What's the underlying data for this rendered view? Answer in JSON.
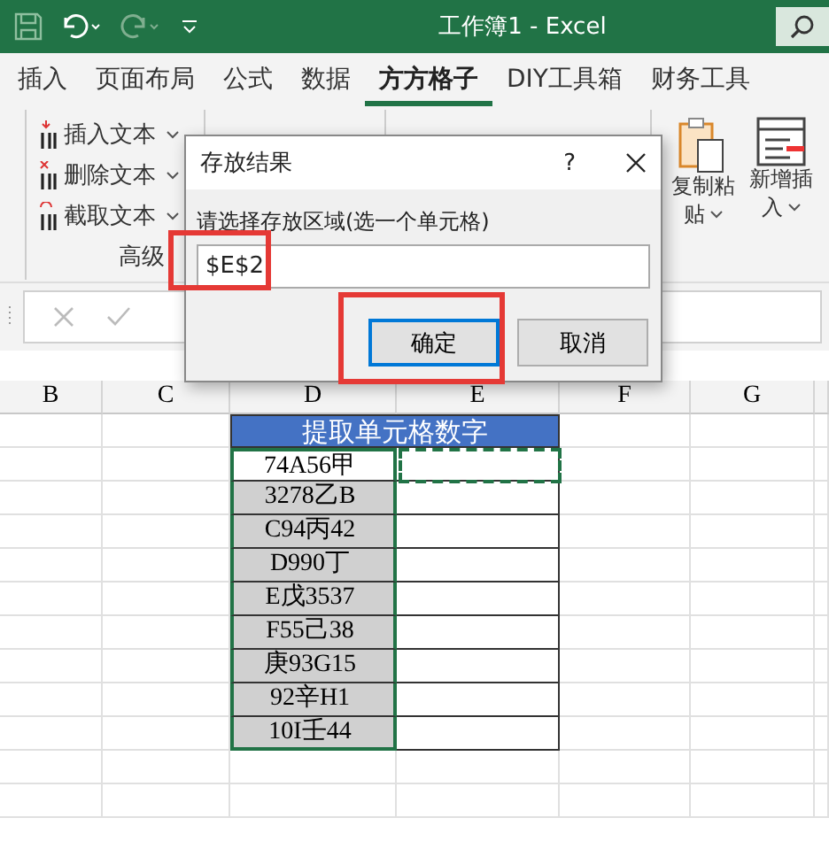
{
  "window": {
    "title": "工作簿1 - Excel"
  },
  "tabs": [
    {
      "label": "插入",
      "selected": false
    },
    {
      "label": "页面布局",
      "selected": false
    },
    {
      "label": "公式",
      "selected": false
    },
    {
      "label": "数据",
      "selected": false
    },
    {
      "label": "方方格子",
      "selected": true
    },
    {
      "label": "DIY工具箱",
      "selected": false
    },
    {
      "label": "财务工具",
      "selected": false
    }
  ],
  "ribbon": {
    "text_tools": [
      "插入文本",
      "删除文本",
      "截取文本"
    ],
    "group_label": "高级",
    "large_buttons": [
      "复制粘贴",
      "新增插入"
    ]
  },
  "sheet": {
    "columns": [
      "B",
      "C",
      "D",
      "E",
      "F",
      "G"
    ],
    "header": "提取单元格数字",
    "rows": [
      {
        "value": "74A56甲",
        "active": true
      },
      {
        "value": "3278乙B",
        "active": false
      },
      {
        "value": "C94丙42",
        "active": false
      },
      {
        "value": "D990丁",
        "active": false
      },
      {
        "value": "E戊3537",
        "active": false
      },
      {
        "value": "F55己38",
        "active": false
      },
      {
        "value": "庚93G15",
        "active": false
      },
      {
        "value": "92辛H1",
        "active": false
      },
      {
        "value": "10I壬44",
        "active": false
      }
    ]
  },
  "dialog": {
    "title": "存放结果",
    "help": "?",
    "prompt": "请选择存放区域(选一个单元格)",
    "value": "$E$2",
    "buttons": [
      {
        "label": "确定",
        "default": true
      },
      {
        "label": "取消",
        "default": false
      }
    ]
  }
}
